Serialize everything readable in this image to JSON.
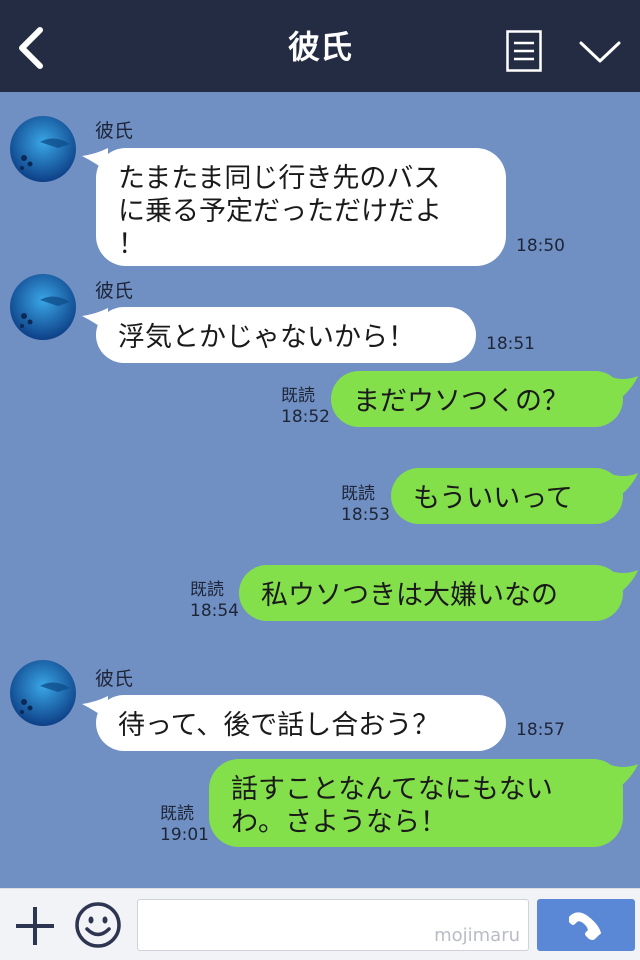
{
  "header": {
    "title": "彼氏"
  },
  "messages": [
    {
      "sender": "彼氏",
      "lines": [
        "たまたま同じ行き先のバス",
        "に乗る予定だっただけだよ",
        "！"
      ],
      "time": "18:50"
    },
    {
      "sender": "彼氏",
      "lines": [
        "浮気とかじゃないから！"
      ],
      "time": "18:51"
    },
    {
      "status": "既読",
      "lines": [
        "まだウソつくの？"
      ],
      "time": "18:52"
    },
    {
      "status": "既読",
      "lines": [
        "もういいって"
      ],
      "time": "18:53"
    },
    {
      "status": "既読",
      "lines": [
        "私ウソつきは大嫌いなの"
      ],
      "time": "18:54"
    },
    {
      "sender": "彼氏",
      "lines": [
        "待って、後で話し合おう？"
      ],
      "time": "18:57"
    },
    {
      "status": "既読",
      "lines": [
        "話すことなんてなにもない",
        "わ。さようなら！"
      ],
      "time": "19:01"
    }
  ],
  "footer": {
    "watermark": "mojimaru"
  },
  "colors": {
    "header": "#232c42",
    "chat_background": "#7090c4",
    "outgoing_bubble": "#84e04a",
    "incoming_bubble": "#ffffff",
    "call_button": "#5a87d6"
  },
  "icons": [
    "back-chevron-icon",
    "memo-icon",
    "chevron-down-icon",
    "plus-icon",
    "emoji-icon",
    "phone-icon"
  ]
}
